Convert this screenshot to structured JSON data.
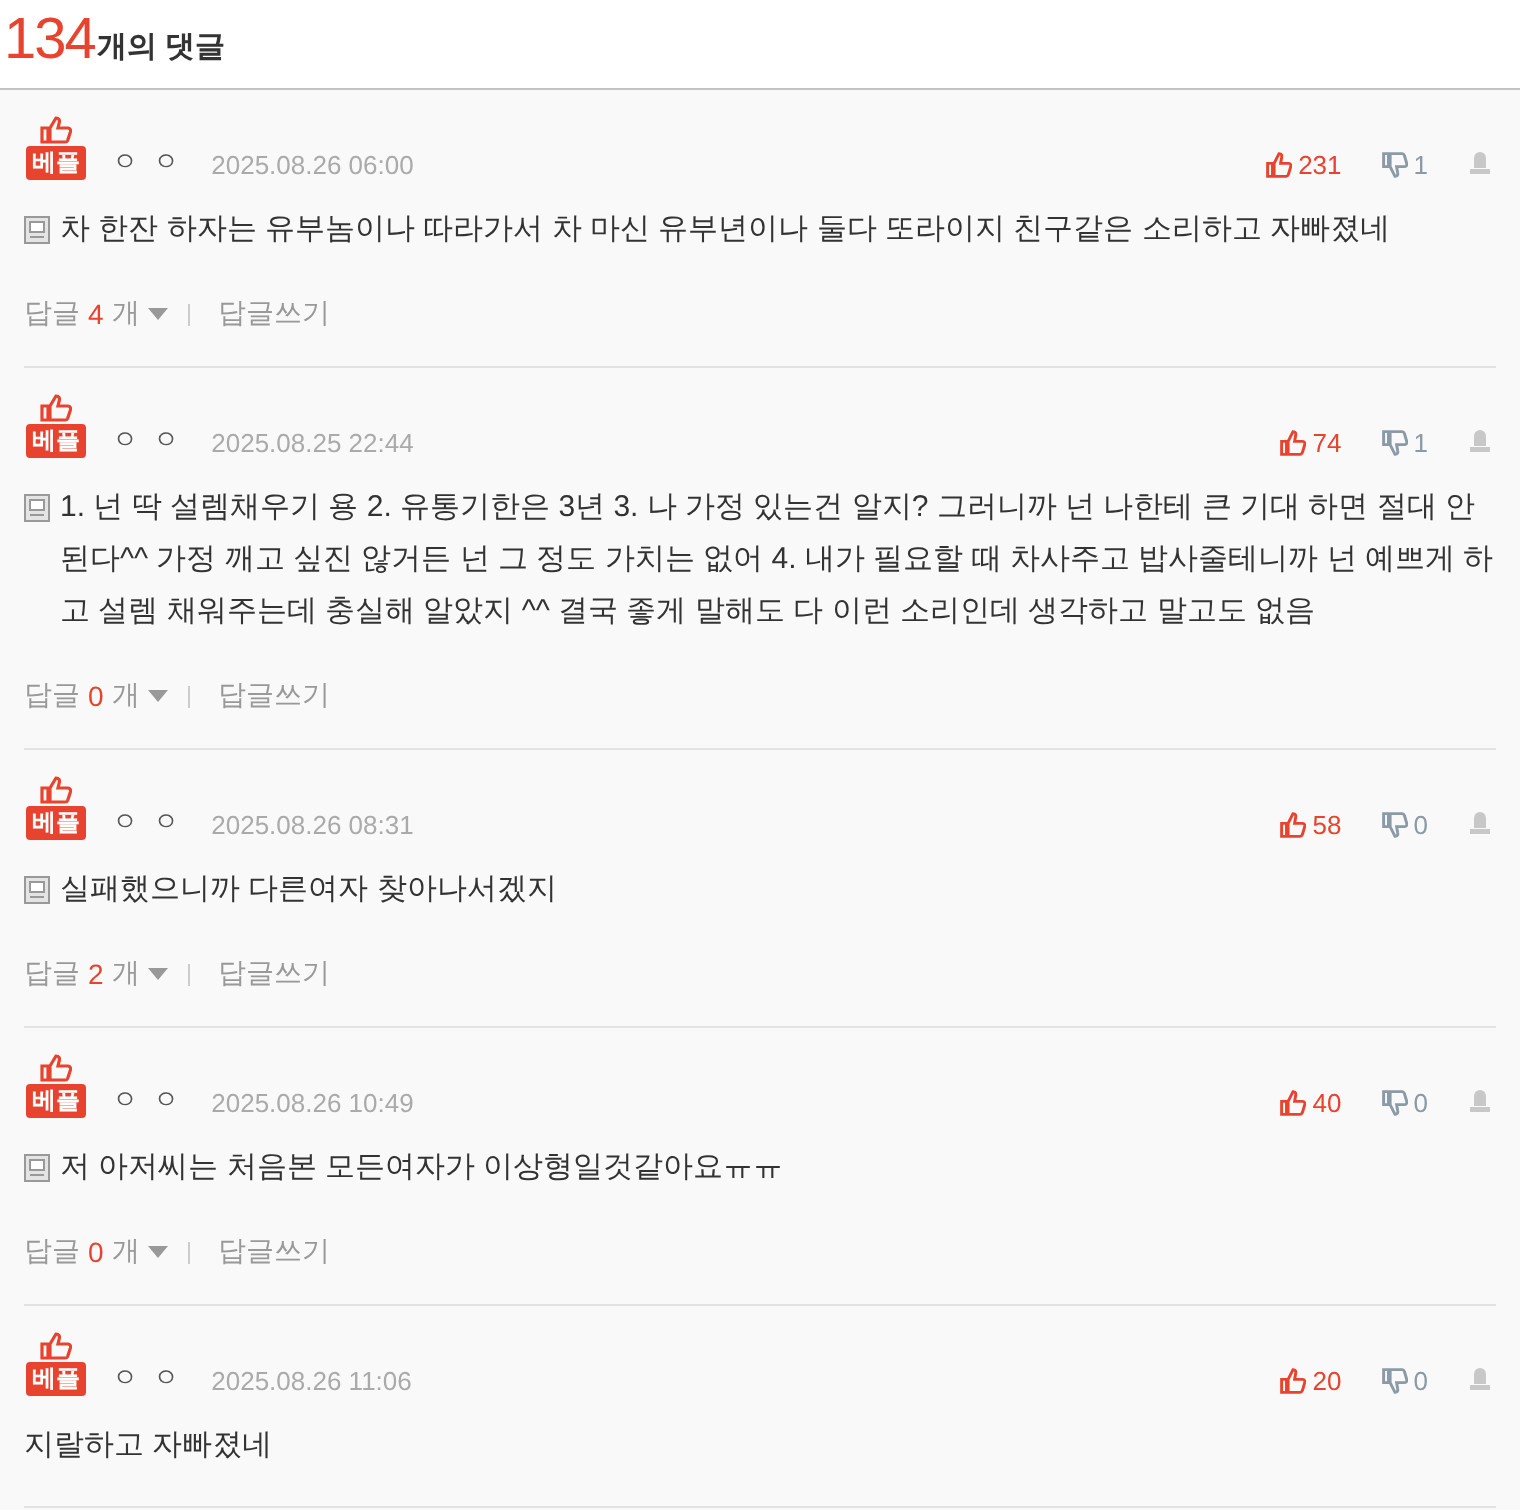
{
  "header": {
    "count": "134",
    "label": "개의 댓글"
  },
  "comments": [
    {
      "badge": "베플",
      "author": "ㅇ ㅇ",
      "date": "2025.08.26 06:00",
      "likes": "231",
      "dislikes": "1",
      "memo": true,
      "text": "차 한잔 하자는 유부놈이나 따라가서 차 마신 유부년이나 둘다 또라이지 친구같은 소리하고 자빠졌네",
      "reply_label": "답글",
      "reply_count": "4",
      "reply_unit": "개",
      "write": "답글쓰기"
    },
    {
      "badge": "베플",
      "author": "ㅇ ㅇ",
      "date": "2025.08.25 22:44",
      "likes": "74",
      "dislikes": "1",
      "memo": true,
      "text": "1. 넌 딱 설렘채우기 용 2. 유통기한은 3년 3. 나 가정 있는건 알지? 그러니까 넌 나한테 큰 기대 하면 절대 안된다^^ 가정 깨고 싶진 않거든 넌 그 정도 가치는 없어 4. 내가 필요할 때 차사주고 밥사줄테니까 넌 예쁘게 하고 설렘 채워주는데 충실해 알았지 ^^ 결국 좋게 말해도 다 이런 소리인데 생각하고 말고도 없음",
      "reply_label": "답글",
      "reply_count": "0",
      "reply_unit": "개",
      "write": "답글쓰기"
    },
    {
      "badge": "베플",
      "author": "ㅇ ㅇ",
      "date": "2025.08.26 08:31",
      "likes": "58",
      "dislikes": "0",
      "memo": true,
      "text": "실패했으니까 다른여자 찾아나서겠지",
      "reply_label": "답글",
      "reply_count": "2",
      "reply_unit": "개",
      "write": "답글쓰기"
    },
    {
      "badge": "베플",
      "author": "ㅇ ㅇ",
      "date": "2025.08.26 10:49",
      "likes": "40",
      "dislikes": "0",
      "memo": true,
      "text": "저 아저씨는 처음본 모든여자가 이상형일것같아요ㅠㅠ",
      "reply_label": "답글",
      "reply_count": "0",
      "reply_unit": "개",
      "write": "답글쓰기"
    },
    {
      "badge": "베플",
      "author": "ㅇ ㅇ",
      "date": "2025.08.26 11:06",
      "likes": "20",
      "dislikes": "0",
      "memo": false,
      "text": "지랄하고 자빠졌네"
    }
  ]
}
